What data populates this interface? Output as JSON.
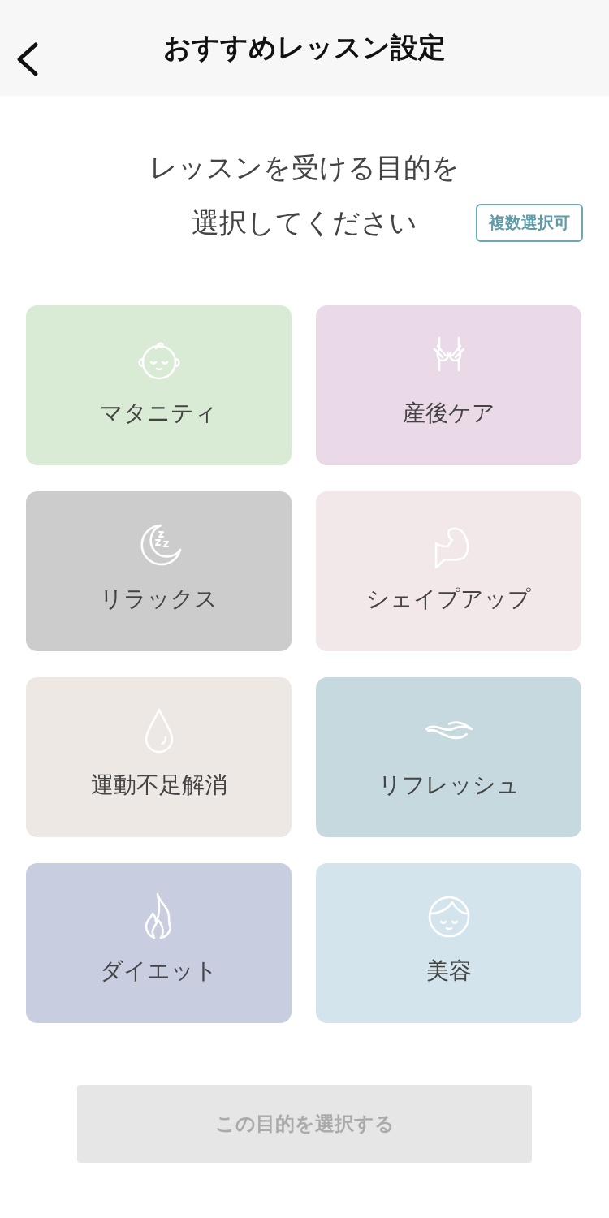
{
  "header": {
    "title": "おすすめレッスン設定"
  },
  "prompt": {
    "lines": [
      "レッスンを受ける目的を",
      "選択してください"
    ],
    "badge": "複数選択可"
  },
  "purposes": [
    {
      "label": "マタニティ",
      "kind": "baby",
      "color": "#d9ebd4",
      "selected": false
    },
    {
      "label": "産後ケア",
      "kind": "hips",
      "color": "#ead9e7",
      "selected": false
    },
    {
      "label": "リラックス",
      "kind": "moon",
      "color": "#cccccc",
      "selected": false
    },
    {
      "label": "シェイプアップ",
      "kind": "muscle",
      "color": "#f2e8e9",
      "selected": false
    },
    {
      "label": "運動不足解消",
      "kind": "drop",
      "color": "#eee8e5",
      "selected": false
    },
    {
      "label": "リフレッシュ",
      "kind": "wind",
      "color": "#c6d9df",
      "selected": false
    },
    {
      "label": "ダイエット",
      "kind": "flame",
      "color": "#c8cde0",
      "selected": false
    },
    {
      "label": "美容",
      "kind": "face",
      "color": "#d3e4ec",
      "selected": false
    }
  ],
  "submit": {
    "label": "この目的を選択する",
    "disabled": true
  }
}
